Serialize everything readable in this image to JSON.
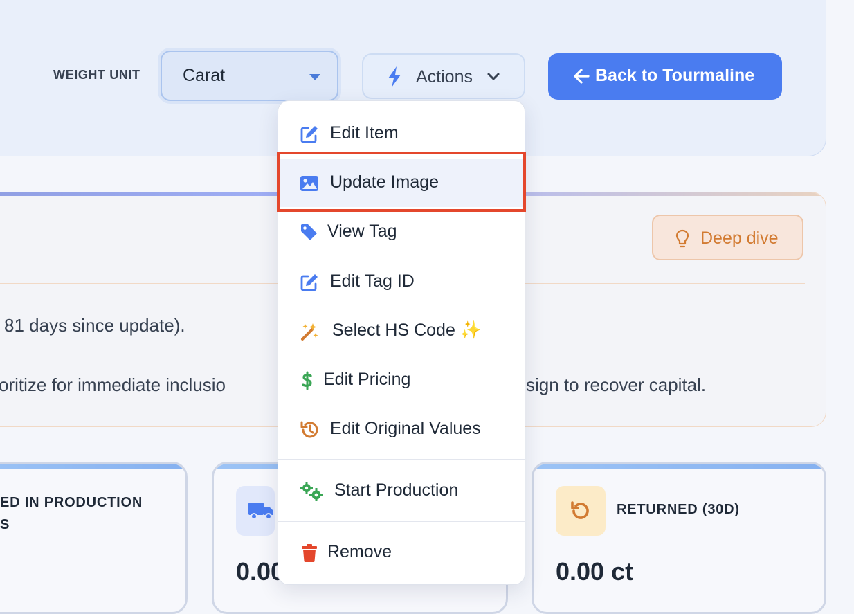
{
  "header": {
    "weight_label": "WEIGHT UNIT",
    "weight_value": "Carat",
    "actions_label": "Actions",
    "back_label": "Back to Tourmaline"
  },
  "insight": {
    "deep_dive_label": "Deep dive",
    "line1": "81 days since update).",
    "line2_left": "oritize for immediate inclusio",
    "line2_right": "sign to recover capital."
  },
  "stats": {
    "card1_title_line1": "ED IN PRODUCTION",
    "card1_title_line2": "S",
    "card2_value": "0.00",
    "card3_title": "RETURNED (30D)",
    "card3_value": "0.00 ct"
  },
  "menu": {
    "items": [
      {
        "label": "Edit Item",
        "icon": "edit-icon"
      },
      {
        "label": "Update Image",
        "icon": "image-icon"
      },
      {
        "label": "View Tag",
        "icon": "tag-icon"
      },
      {
        "label": "Edit Tag ID",
        "icon": "edit-icon"
      },
      {
        "label": "Select HS Code ✨",
        "icon": "magic-wand-icon"
      },
      {
        "label": "Edit Pricing",
        "icon": "dollar-icon"
      },
      {
        "label": "Edit Original Values",
        "icon": "history-icon"
      },
      {
        "label": "Start Production",
        "icon": "gears-icon"
      },
      {
        "label": "Remove",
        "icon": "trash-icon"
      }
    ]
  },
  "colors": {
    "primary": "#4a7cf0",
    "highlight": "#e4472c",
    "deep_dive": "#d27b32",
    "pricing": "#3aa655",
    "remove": "#e4472c"
  }
}
